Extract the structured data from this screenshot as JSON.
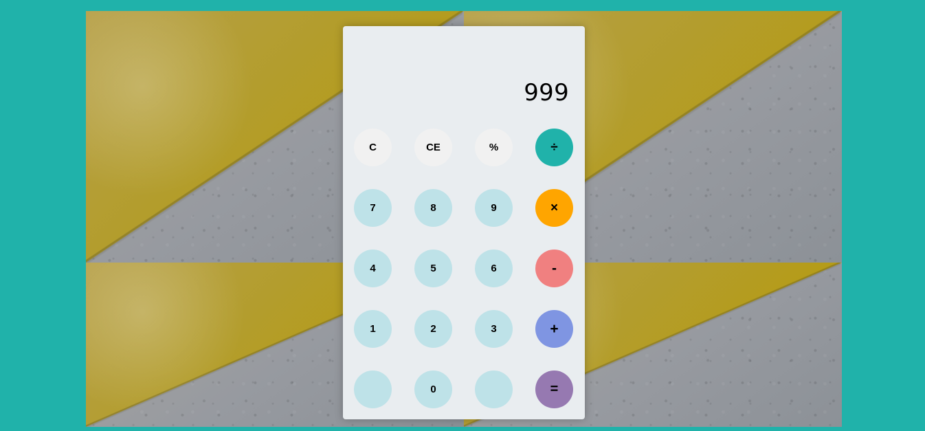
{
  "background": {
    "page_color": "#20b2aa",
    "pattern_colors": [
      "#b89b00",
      "#979aa0"
    ]
  },
  "calculator": {
    "display_value": "999",
    "keys": {
      "clear": "C",
      "clear_entry": "CE",
      "percent": "%",
      "divide": "÷",
      "seven": "7",
      "eight": "8",
      "nine": "9",
      "multiply": "×",
      "four": "4",
      "five": "5",
      "six": "6",
      "minus": "-",
      "one": "1",
      "two": "2",
      "three": "3",
      "plus": "+",
      "blank_left": "",
      "zero": "0",
      "blank_right": "",
      "equals": "="
    },
    "colors": {
      "panel": "#e9edf0",
      "function_key": "#f1f1f1",
      "number_key": "#bee2e8",
      "divide": "#20b2aa",
      "multiply": "#ffa500",
      "minus": "#f08080",
      "plus": "#7f95e2",
      "equals": "#9679b1"
    }
  }
}
